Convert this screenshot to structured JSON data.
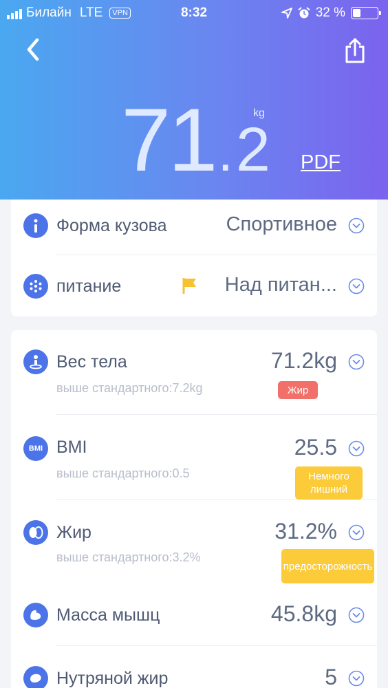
{
  "status_bar": {
    "carrier": "Билайн",
    "network": "LTE",
    "vpn": "VPN",
    "time": "8:32",
    "battery_percent": "32 %",
    "battery_level": 0.32,
    "icons": [
      "signal-icon",
      "location-arrow-icon",
      "alarm-icon",
      "battery-icon"
    ]
  },
  "header": {
    "weight_int": "71",
    "weight_dot": ".",
    "weight_frac": "2",
    "weight_unit": "kg",
    "pdf_label": "PDF",
    "icons": [
      "back-chevron-icon",
      "share-icon"
    ]
  },
  "summary": [
    {
      "label": "Форма кузова",
      "value": "Спортивное",
      "icon": "info-icon"
    },
    {
      "label": "питание",
      "value": "Над питан...",
      "icon": "nutrition-icon",
      "flag_icon": "flag-icon"
    }
  ],
  "metrics": [
    {
      "label": "Вес тела",
      "value": "71.2kg",
      "subtitle": "выше стандартного:7.2kg",
      "badge": "Жир",
      "icon": "weight-icon"
    },
    {
      "label": "BMI",
      "value": "25.5",
      "subtitle": "выше стандартного:0.5",
      "badge": "Немного лишний",
      "icon_text": "BMI"
    },
    {
      "label": "Жир",
      "value": "31.2%",
      "subtitle": "выше стандартного:3.2%",
      "badge": "предосторожность",
      "icon": "fat-icon"
    },
    {
      "label": "Масса мышц",
      "value": "45.8kg",
      "icon": "muscle-icon"
    },
    {
      "label": "Нутряной жир",
      "value": "5",
      "icon": "visceral-fat-icon"
    }
  ],
  "colors": {
    "header_gradient_start": "#4aa8f0",
    "header_gradient_end": "#7b63ee",
    "icon_blue": "#4c74e8",
    "badge_red": "#f2706a",
    "badge_yellow": "#fbcb3a",
    "flag_yellow": "#f6c230"
  }
}
